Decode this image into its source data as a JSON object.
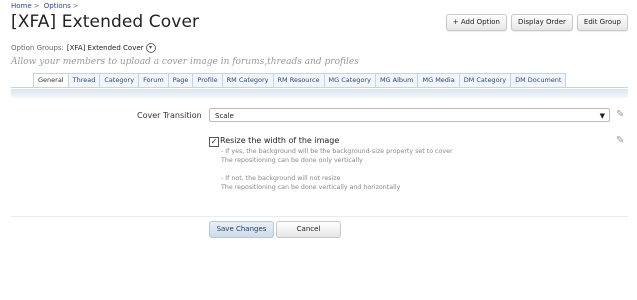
{
  "breadcrumb": {
    "home": "Home",
    "sep1": ">",
    "options": "Options",
    "sep2": ">"
  },
  "page_title": "[XFA] Extended Cover",
  "top_buttons": {
    "add_option": "+ Add Option",
    "display_order": "Display Order",
    "edit_group": "Edit Group"
  },
  "option_groups": {
    "label": "Option Groups:",
    "value": "[XFA] Extended Cover",
    "icon": "chevron-down-icon"
  },
  "description": "Allow your members to upload a cover image in forums,threads and profiles",
  "tabs": [
    "General",
    "Thread",
    "Category",
    "Forum",
    "Page",
    "Profile",
    "RM Category",
    "RM Resource",
    "MG Category",
    "MG Album",
    "MG Media",
    "DM Category",
    "DM Document"
  ],
  "active_tab": "General",
  "form": {
    "cover_transition": {
      "label": "Cover Transition",
      "value": "Scale",
      "arrow": "▼"
    },
    "resize": {
      "checked": true,
      "label": "Resize the width of the image",
      "hint1": "- If yes, the background will be the background-size property set to cover",
      "hint2": "The repositioning can be done only vertically",
      "hint3": "- If not, the background will not resize",
      "hint4": "The repositioning can be done vertically and horizontally"
    }
  },
  "footer": {
    "save": "Save Changes",
    "cancel": "Cancel"
  }
}
